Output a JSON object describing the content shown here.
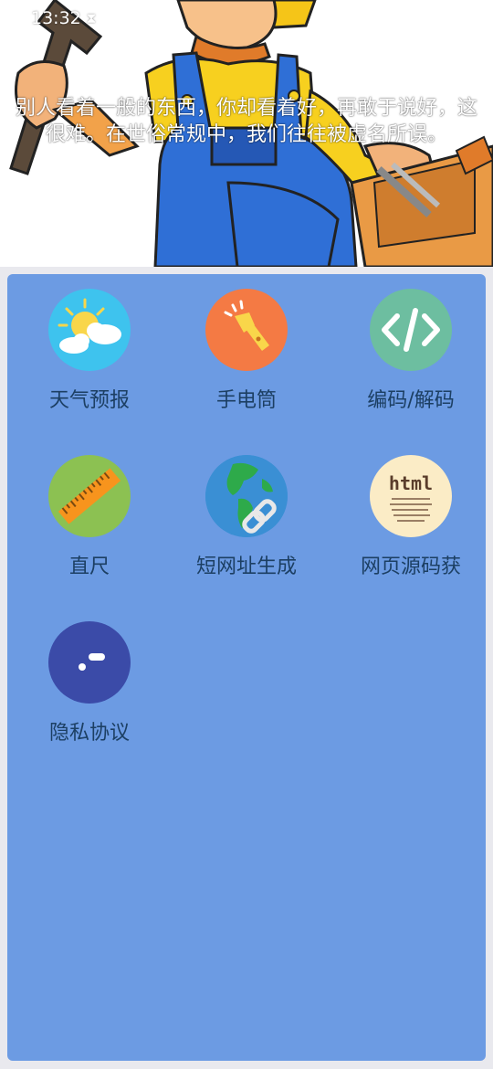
{
  "status_bar": {
    "time": "13:32",
    "indicator_icon": "hourglass-icon"
  },
  "header": {
    "quote": "别人看着一般的东西，你却看着好，再敢于说好，这很难。在世俗常规中，我们往往被虚名所误。"
  },
  "tools": [
    {
      "label": "天气预报",
      "icon": "weather-icon",
      "color": "#3ec3ee"
    },
    {
      "label": "手电筒",
      "icon": "flashlight-icon",
      "color": "#f47a44"
    },
    {
      "label": "编码/解码",
      "icon": "code-icon",
      "color": "#6dbea0"
    },
    {
      "label": "直尺",
      "icon": "ruler-icon",
      "color": "#8cc152"
    },
    {
      "label": "短网址生成",
      "icon": "globe-link-icon",
      "color": "#3a8fd4"
    },
    {
      "label": "网页源码获",
      "icon": "html-source-icon",
      "color": "#fbecc6"
    },
    {
      "label": "隐私协议",
      "icon": "privacy-icon",
      "color": "#3b4ba8"
    }
  ],
  "colors": {
    "panel": "#6c9be3",
    "label_text": "#1c3f63"
  }
}
